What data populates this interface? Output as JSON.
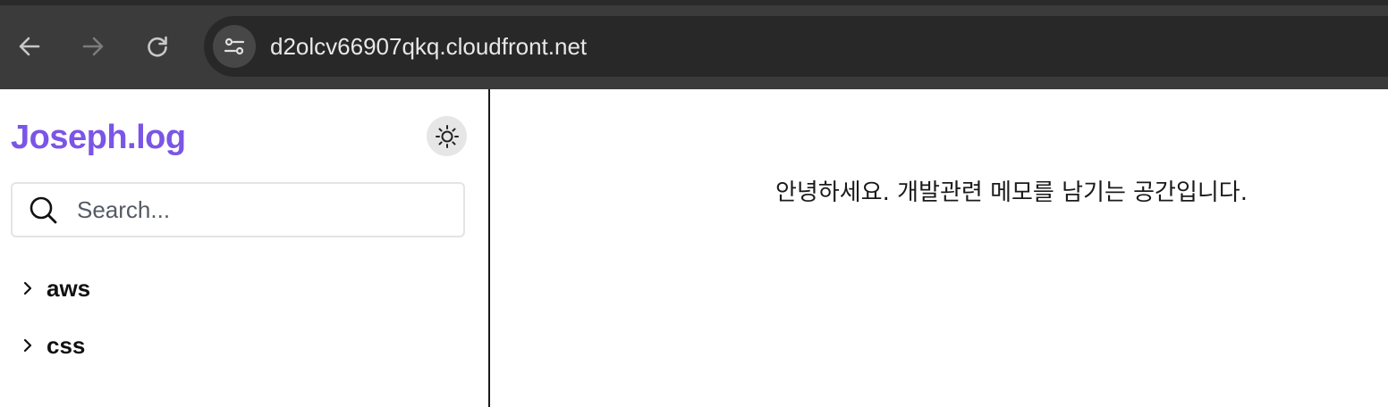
{
  "browser": {
    "url": "d2olcv66907qkq.cloudfront.net",
    "icons": {
      "back": "arrow-left-icon",
      "forward": "arrow-right-icon",
      "reload": "reload-icon",
      "site_info": "site-settings-icon"
    }
  },
  "sidebar": {
    "brand": "Joseph.log",
    "brand_color": "#7b55e6",
    "theme_toggle_icon": "sun-icon",
    "search": {
      "placeholder": "Search...",
      "value": ""
    },
    "categories": [
      {
        "label": "aws"
      },
      {
        "label": "css"
      }
    ]
  },
  "main": {
    "intro": "안녕하세요. 개발관련 메모를 남기는 공간입니다."
  }
}
